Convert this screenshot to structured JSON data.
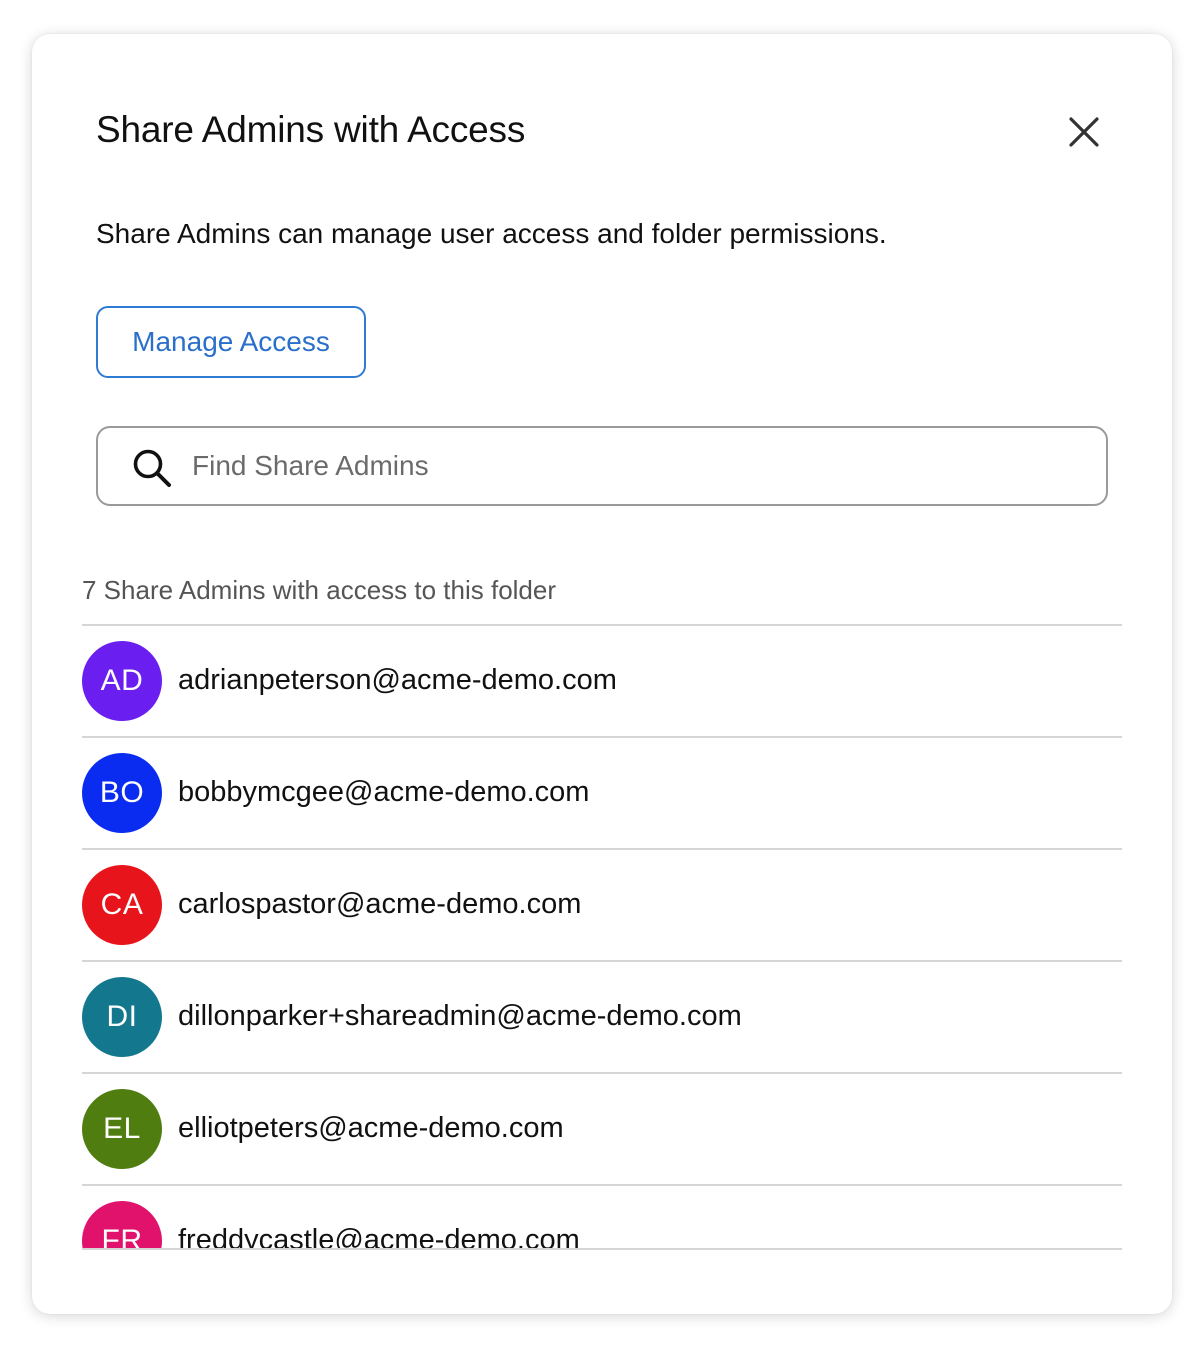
{
  "dialog": {
    "title": "Share Admins with Access",
    "close_icon": "close-icon",
    "description": "Share Admins can manage user access and folder permissions.",
    "manage_button_label": "Manage Access",
    "accent_color": "#2f7bd3"
  },
  "search": {
    "icon": "search-icon",
    "placeholder": "Find Share Admins",
    "value": ""
  },
  "list": {
    "header": "7 Share Admins with access to this folder",
    "items": [
      {
        "initials": "AD",
        "email": "adrianpeterson@acme-demo.com",
        "color": "#6a1ff0"
      },
      {
        "initials": "BO",
        "email": "bobbymcgee@acme-demo.com",
        "color": "#0a2cf0"
      },
      {
        "initials": "CA",
        "email": "carlospastor@acme-demo.com",
        "color": "#e8141b"
      },
      {
        "initials": "DI",
        "email": "dillonparker+shareadmin@acme-demo.com",
        "color": "#13788e"
      },
      {
        "initials": "EL",
        "email": "elliotpeters@acme-demo.com",
        "color": "#4f7d10"
      },
      {
        "initials": "FR",
        "email": "freddycastle@acme-demo.com",
        "color": "#e0126c"
      }
    ]
  }
}
